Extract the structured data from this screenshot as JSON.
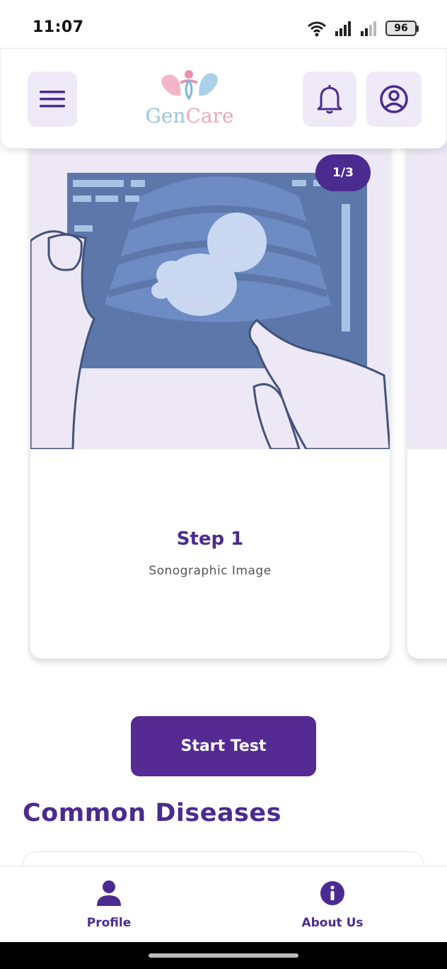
{
  "status_bar": {
    "time": "11:07",
    "battery": "96"
  },
  "header": {
    "logo": {
      "text_gen": "Gen",
      "text_care": "Care"
    },
    "menu_icon": "menu-icon",
    "notification_icon": "bell-icon",
    "account_icon": "account-circle-icon"
  },
  "carousel": {
    "indicator": "1/3",
    "slides": [
      {
        "title": "Step 1",
        "subtitle": "Sonographic Image",
        "image": "ultrasound-illustration"
      }
    ]
  },
  "start_button": {
    "label": "Start Test"
  },
  "common_diseases": {
    "title": "Common Diseases"
  },
  "bottom_nav": {
    "items": [
      {
        "label": "Profile",
        "icon": "person-icon"
      },
      {
        "label": "About Us",
        "icon": "info-icon"
      }
    ]
  },
  "colors": {
    "primary": "#4b2b8f",
    "button": "#552a93",
    "icon_button_bg": "#efeaf7",
    "card_image_bg": "#ede8f5"
  }
}
